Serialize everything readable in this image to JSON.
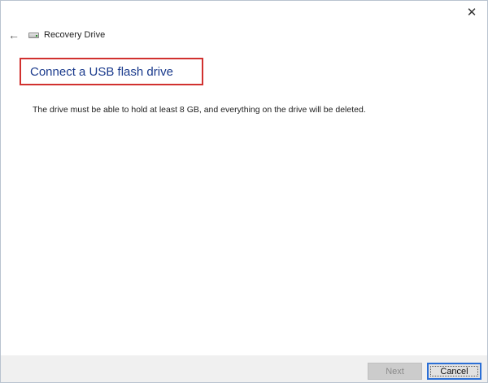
{
  "window": {
    "title": "Recovery Drive",
    "close_glyph": "✕",
    "back_glyph": "←"
  },
  "main": {
    "heading": "Connect a USB flash drive",
    "description": "The drive must be able to hold at least 8 GB, and everything on the drive will be deleted."
  },
  "footer": {
    "next_label": "Next",
    "cancel_label": "Cancel"
  },
  "colors": {
    "heading": "#1a3a8c",
    "highlight_border": "#d1312f",
    "focus_border": "#2b6fd6"
  }
}
